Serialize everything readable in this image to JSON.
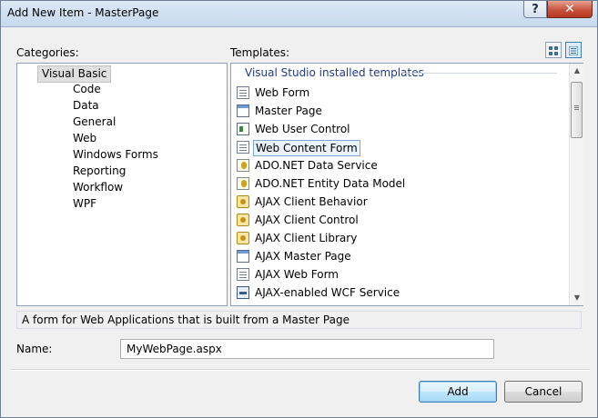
{
  "window": {
    "title": "Add New Item - MasterPage",
    "help_label": "?",
    "close_label": "✕"
  },
  "categories": {
    "label": "Categories:",
    "root": "Visual Basic",
    "items": [
      "Code",
      "Data",
      "General",
      "Web",
      "Windows Forms",
      "Reporting",
      "Workflow",
      "WPF"
    ]
  },
  "templates": {
    "label": "Templates:",
    "group": "Visual Studio installed templates",
    "selected": "Web Content Form",
    "items": [
      {
        "label": "Web Form",
        "icon": "web-form-icon"
      },
      {
        "label": "Master Page",
        "icon": "master-page-icon"
      },
      {
        "label": "Web User Control",
        "icon": "user-control-icon"
      },
      {
        "label": "Web Content Form",
        "icon": "web-content-form-icon"
      },
      {
        "label": "ADO.NET Data Service",
        "icon": "ado-data-service-icon"
      },
      {
        "label": "ADO.NET Entity Data Model",
        "icon": "entity-data-model-icon"
      },
      {
        "label": "AJAX Client Behavior",
        "icon": "ajax-client-behavior-icon"
      },
      {
        "label": "AJAX Client Control",
        "icon": "ajax-client-control-icon"
      },
      {
        "label": "AJAX Client Library",
        "icon": "ajax-client-library-icon"
      },
      {
        "label": "AJAX Master Page",
        "icon": "ajax-master-page-icon"
      },
      {
        "label": "AJAX Web Form",
        "icon": "ajax-web-form-icon"
      },
      {
        "label": "AJAX-enabled WCF Service",
        "icon": "wcf-service-icon"
      }
    ]
  },
  "description": "A form for Web Applications that is built from a Master Page",
  "name_field": {
    "label": "Name:",
    "value": "MyWebPage.aspx"
  },
  "buttons": {
    "add": "Add",
    "cancel": "Cancel"
  }
}
